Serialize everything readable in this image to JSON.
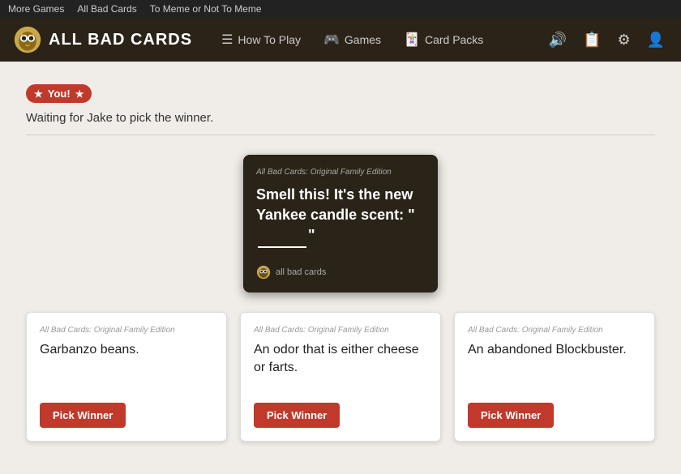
{
  "browser_bar": {
    "links": [
      {
        "label": "More Games",
        "href": "#"
      },
      {
        "label": "All Bad Cards",
        "href": "#"
      },
      {
        "label": "To Meme or Not To Meme",
        "href": "#"
      }
    ]
  },
  "nav": {
    "brand": "ALL BAD CARDS",
    "links": [
      {
        "label": "How To Play",
        "icon": "☰",
        "href": "#"
      },
      {
        "label": "Games",
        "icon": "🎮",
        "href": "#"
      },
      {
        "label": "Card Packs",
        "icon": "🃏",
        "href": "#"
      }
    ]
  },
  "you_badge": "You!",
  "waiting_text": "Waiting for Jake to pick the winner.",
  "black_card": {
    "edition": "All Bad Cards: Original Family Edition",
    "text_before": "Smell this! It's the new Yankee candle scent: \"",
    "blank": true,
    "text_after": "\"",
    "footer": "all bad cards"
  },
  "white_cards": [
    {
      "edition": "All Bad Cards: Original Family Edition",
      "text": "Garbanzo beans.",
      "button_label": "Pick Winner"
    },
    {
      "edition": "All Bad Cards: Original Family Edition",
      "text": "An odor that is either cheese or farts.",
      "button_label": "Pick Winner"
    },
    {
      "edition": "All Bad Cards: Original Family Edition",
      "text": "An abandoned Blockbuster.",
      "button_label": "Pick Winner"
    }
  ]
}
